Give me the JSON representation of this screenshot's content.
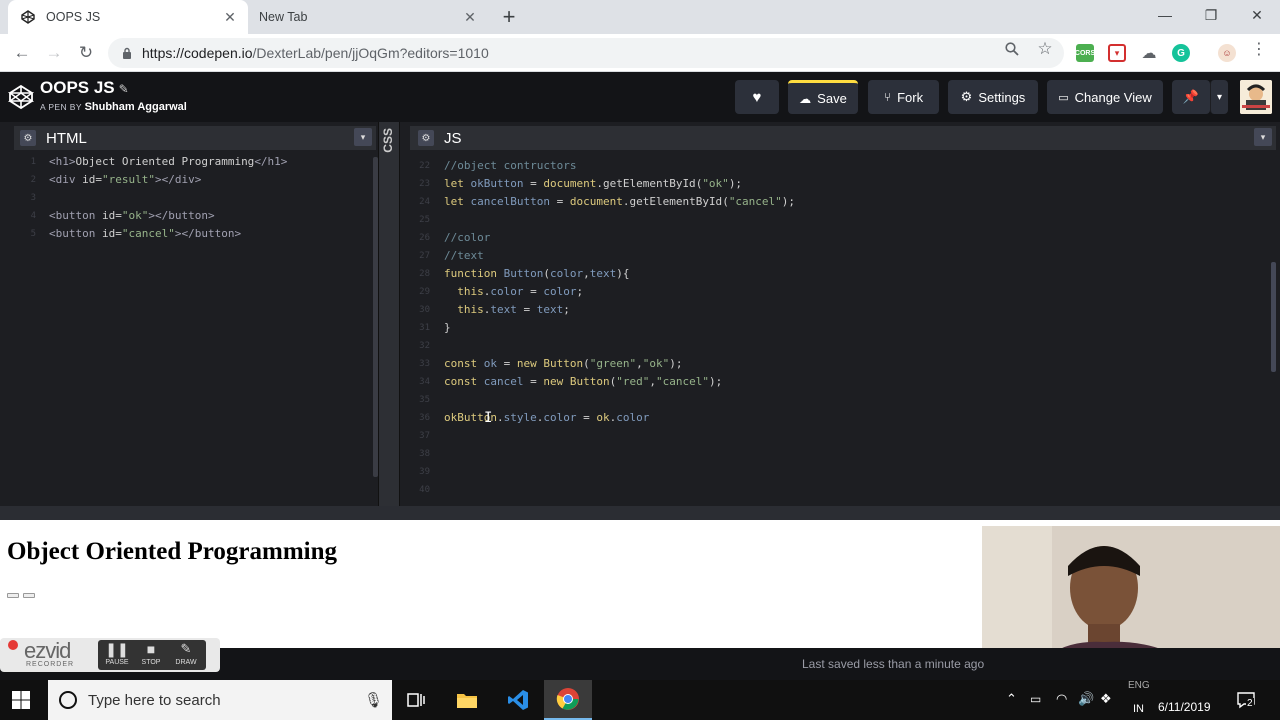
{
  "browser": {
    "tabs": [
      {
        "title": "OOPS JS",
        "active": true
      },
      {
        "title": "New Tab",
        "active": false
      }
    ],
    "url_main": "https://codepen.io",
    "url_path": "/DexterLab/pen/jjOqGm?editors=1010"
  },
  "codepen": {
    "pen_title": "OOPS JS",
    "byline_prefix": "A PEN BY",
    "author": "Shubham Aggarwal",
    "buttons": {
      "save": "Save",
      "fork": "Fork",
      "settings": "Settings",
      "change_view": "Change View"
    },
    "html_label": "HTML",
    "css_label": "CSS",
    "js_label": "JS",
    "footer_status": "Last saved less than a minute ago"
  },
  "html_code": [
    {
      "n": "1",
      "parts": [
        [
          "tag",
          "<h1>"
        ],
        [
          "pr",
          "Object Oriented Programming"
        ],
        [
          "tag",
          "</h1>"
        ]
      ]
    },
    {
      "n": "2",
      "parts": [
        [
          "tag",
          "<div "
        ],
        [
          "pr",
          "id="
        ],
        [
          "str",
          "\"result\""
        ],
        [
          "tag",
          "></div>"
        ]
      ]
    },
    {
      "n": "3",
      "parts": []
    },
    {
      "n": "4",
      "parts": [
        [
          "tag",
          "<button "
        ],
        [
          "pr",
          "id="
        ],
        [
          "str",
          "\"ok\""
        ],
        [
          "tag",
          "></button>"
        ]
      ]
    },
    {
      "n": "5",
      "parts": [
        [
          "tag",
          "<button "
        ],
        [
          "pr",
          "id="
        ],
        [
          "str",
          "\"cancel\""
        ],
        [
          "tag",
          "></button>"
        ]
      ]
    }
  ],
  "js_code": [
    {
      "n": "22",
      "parts": [
        [
          "cm",
          "//object contructors"
        ]
      ]
    },
    {
      "n": "23",
      "parts": [
        [
          "kw",
          "let "
        ],
        [
          "var",
          "okButton"
        ],
        [
          "pr",
          " = "
        ],
        [
          "kw",
          "document"
        ],
        [
          "pr",
          "."
        ],
        [
          "fn",
          "getElementById"
        ],
        [
          "pr",
          "("
        ],
        [
          "str",
          "\"ok\""
        ],
        [
          "pr",
          ");"
        ]
      ]
    },
    {
      "n": "24",
      "parts": [
        [
          "kw",
          "let "
        ],
        [
          "var",
          "cancelButton"
        ],
        [
          "pr",
          " = "
        ],
        [
          "kw",
          "document"
        ],
        [
          "pr",
          "."
        ],
        [
          "fn",
          "getElementById"
        ],
        [
          "pr",
          "("
        ],
        [
          "str",
          "\"cancel\""
        ],
        [
          "pr",
          ");"
        ]
      ]
    },
    {
      "n": "25",
      "parts": []
    },
    {
      "n": "26",
      "parts": [
        [
          "cm",
          "//color"
        ]
      ]
    },
    {
      "n": "27",
      "parts": [
        [
          "cm",
          "//text"
        ]
      ]
    },
    {
      "n": "28",
      "parts": [
        [
          "kw",
          "function "
        ],
        [
          "var",
          "Button"
        ],
        [
          "pr",
          "("
        ],
        [
          "var",
          "color"
        ],
        [
          "pr",
          ","
        ],
        [
          "var",
          "text"
        ],
        [
          "pr",
          "){"
        ]
      ]
    },
    {
      "n": "29",
      "parts": [
        [
          "pr",
          "  "
        ],
        [
          "kw",
          "this"
        ],
        [
          "pr",
          "."
        ],
        [
          "var",
          "color"
        ],
        [
          "pr",
          " = "
        ],
        [
          "var",
          "color"
        ],
        [
          "pr",
          ";"
        ]
      ]
    },
    {
      "n": "30",
      "parts": [
        [
          "pr",
          "  "
        ],
        [
          "kw",
          "this"
        ],
        [
          "pr",
          "."
        ],
        [
          "var",
          "text"
        ],
        [
          "pr",
          " = "
        ],
        [
          "var",
          "text"
        ],
        [
          "pr",
          ";"
        ]
      ]
    },
    {
      "n": "31",
      "parts": [
        [
          "pr",
          "}"
        ]
      ]
    },
    {
      "n": "32",
      "parts": []
    },
    {
      "n": "33",
      "parts": [
        [
          "kw",
          "const "
        ],
        [
          "var",
          "ok"
        ],
        [
          "pr",
          " = "
        ],
        [
          "kw",
          "new "
        ],
        [
          "kw",
          "Button"
        ],
        [
          "pr",
          "("
        ],
        [
          "str",
          "\"green\""
        ],
        [
          "pr",
          ","
        ],
        [
          "str",
          "\"ok\""
        ],
        [
          "pr",
          ");"
        ]
      ]
    },
    {
      "n": "34",
      "parts": [
        [
          "kw",
          "const "
        ],
        [
          "var",
          "cancel"
        ],
        [
          "pr",
          " = "
        ],
        [
          "kw",
          "new "
        ],
        [
          "kw",
          "Button"
        ],
        [
          "pr",
          "("
        ],
        [
          "str",
          "\"red\""
        ],
        [
          "pr",
          ","
        ],
        [
          "str",
          "\"cancel\""
        ],
        [
          "pr",
          ");"
        ]
      ]
    },
    {
      "n": "35",
      "parts": []
    },
    {
      "n": "36",
      "parts": [
        [
          "kw",
          "okButton"
        ],
        [
          "pr",
          "."
        ],
        [
          "var",
          "style"
        ],
        [
          "pr",
          "."
        ],
        [
          "var",
          "color"
        ],
        [
          "pr",
          " = "
        ],
        [
          "kw",
          "ok"
        ],
        [
          "pr",
          "."
        ],
        [
          "var",
          "color"
        ]
      ]
    },
    {
      "n": "37",
      "parts": []
    },
    {
      "n": "38",
      "parts": []
    },
    {
      "n": "39",
      "parts": []
    },
    {
      "n": "40",
      "parts": []
    }
  ],
  "preview": {
    "heading": "Object Oriented Programming"
  },
  "recorder": {
    "brand": "ezvid",
    "sub": "RECORDER",
    "pause": "PAUSE",
    "stop": "STOP",
    "draw": "DRAW"
  },
  "taskbar": {
    "search_placeholder": "Type here to search",
    "lang": "IN",
    "lang_top": "ENG",
    "date": "6/11/2019",
    "notifications": "2"
  },
  "colors": {
    "codepen_bg": "#131417",
    "editor_bg": "#1d1e22",
    "save_accent": "#ffdd40"
  }
}
